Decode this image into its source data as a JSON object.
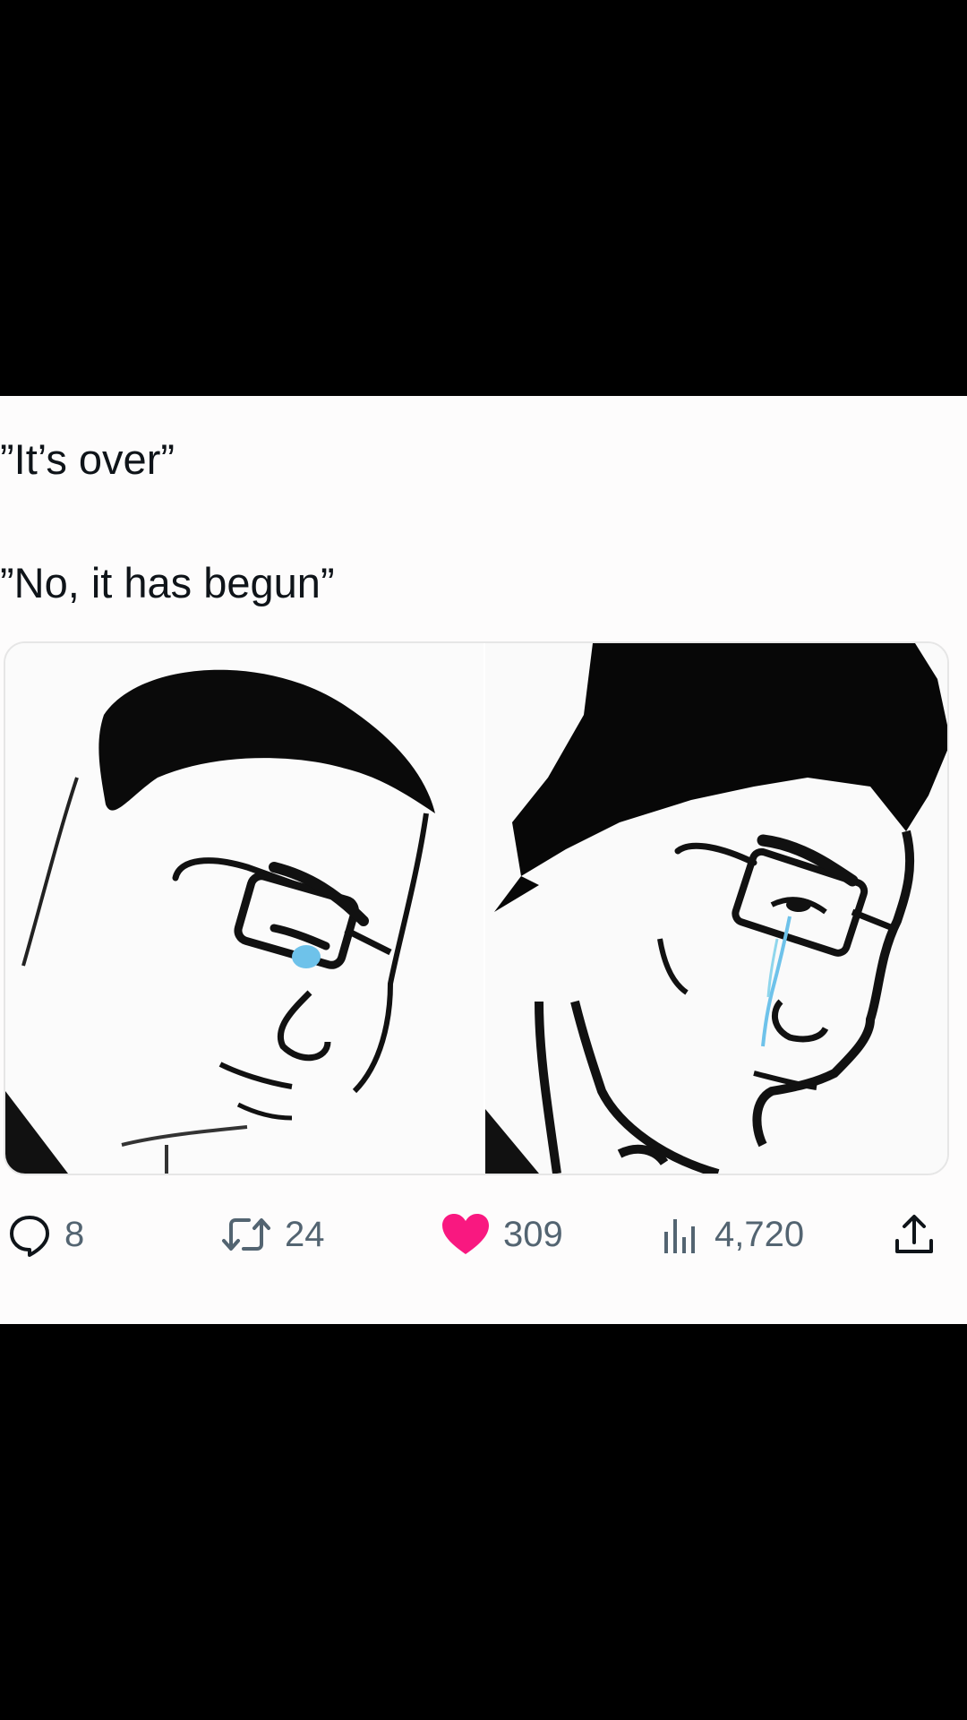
{
  "tweet": {
    "lines": [
      "”It’s over”",
      "”No, it has begun”"
    ]
  },
  "media": {
    "panels": [
      {
        "name": "left-panel",
        "description_icon": "crying-glasses-man-icon"
      },
      {
        "name": "right-panel",
        "description_icon": "crying-glasses-man-icon"
      }
    ]
  },
  "actions": {
    "reply": {
      "icon": "reply-bubble-icon",
      "count": "8"
    },
    "retweet": {
      "icon": "retweet-icon",
      "count": "24"
    },
    "like": {
      "icon": "heart-icon",
      "count": "309",
      "color": "#f91880"
    },
    "views": {
      "icon": "views-bars-icon",
      "count": "4,720"
    },
    "share": {
      "icon": "share-upload-icon"
    }
  },
  "colors": {
    "background": "#000000",
    "card": "#fdfcfc",
    "text": "#0f1419",
    "muted": "#536471",
    "like": "#f91880",
    "tear": "#6ec2ea"
  }
}
